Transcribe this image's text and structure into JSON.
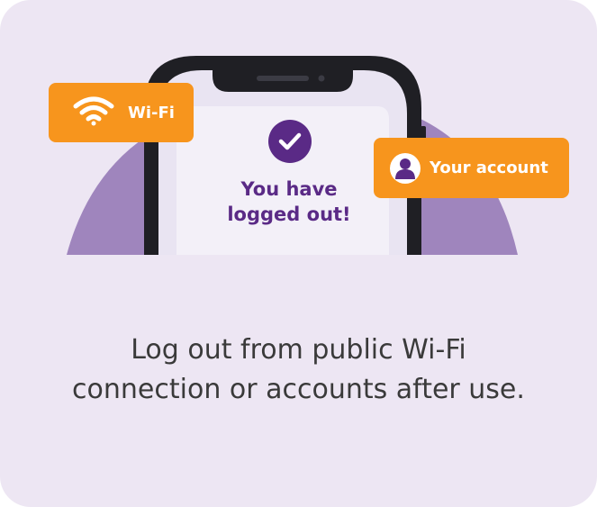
{
  "illustration": {
    "wifi_label": "Wi-Fi",
    "account_label": "Your account",
    "screen_message_line1": "You have",
    "screen_message_line2": "logged out!",
    "icons": {
      "wifi": "wifi-icon",
      "account": "user-account-icon",
      "check": "checkmark-icon"
    }
  },
  "caption": {
    "line1": "Log out from public Wi-Fi",
    "line2": "connection or accounts after use."
  },
  "colors": {
    "card_background": "#ede6f3",
    "accent_orange": "#f7951d",
    "brand_purple": "#5a2a86",
    "hill_purple": "#9f85bd",
    "phone_frame": "#1f1f24",
    "phone_screen": "#e9e4f2"
  }
}
